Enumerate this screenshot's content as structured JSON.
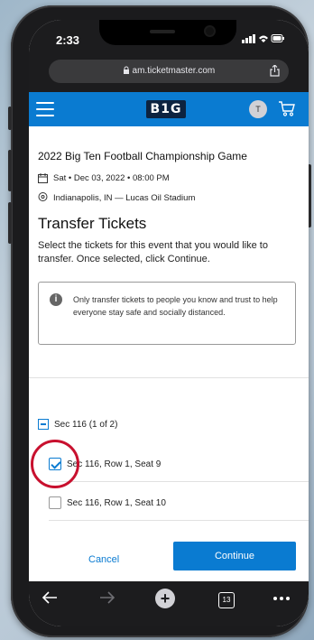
{
  "status_bar": {
    "time": "2:33",
    "signal_icons": "signal-wifi-battery-icons"
  },
  "browser": {
    "url": "am.ticketmaster.com",
    "tabs_count": "13"
  },
  "app_bar": {
    "logo": "B1G",
    "avatar_initial": "T"
  },
  "event": {
    "title": "2022 Big Ten Football Championship Game",
    "date": "Sat • Dec 03, 2022 • 08:00 PM",
    "location": "Indianapolis, IN — Lucas Oil Stadium"
  },
  "transfer": {
    "heading": "Transfer Tickets",
    "description": "Select the tickets for this event that you would like to transfer. Once selected, click Continue.",
    "notice": "Only transfer tickets to people you know and trust to help everyone stay safe and socially distanced."
  },
  "section": {
    "label": "Sec 116 (1 of 2)",
    "seats": [
      {
        "label": "Sec 116, Row 1, Seat 9",
        "checked": true
      },
      {
        "label": "Sec 116, Row 1, Seat 10",
        "checked": false
      }
    ]
  },
  "actions": {
    "cancel_label": "Cancel",
    "continue_label": "Continue"
  },
  "colors": {
    "accent": "#0a7bd1",
    "highlight": "#c8102e"
  }
}
